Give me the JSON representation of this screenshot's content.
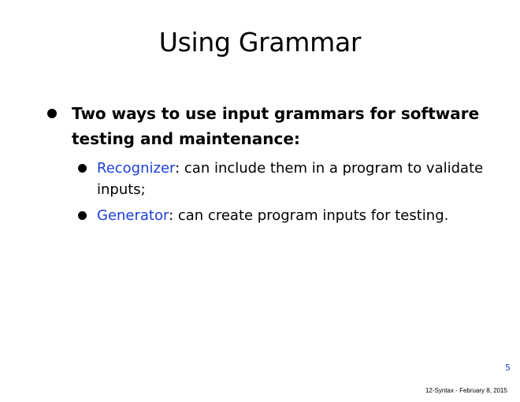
{
  "slide": {
    "title": "Using Grammar",
    "bullet": "Two ways to use input grammars for software testing and maintenance:",
    "sub_bullets": [
      {
        "term": "Recognizer",
        "rest": ": can include them in a program to validate inputs;"
      },
      {
        "term": "Generator",
        "rest": ": can create program inputs for testing."
      }
    ],
    "page_number": "5",
    "footer": "12-Syntax - February 8, 2015"
  },
  "colors": {
    "term": "#1a3fd6",
    "text": "#000000",
    "background": "#ffffff"
  }
}
